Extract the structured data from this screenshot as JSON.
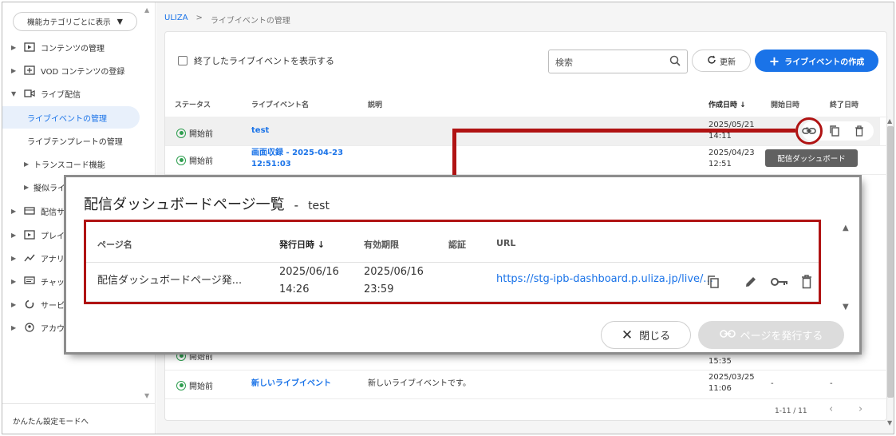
{
  "sidebar": {
    "category_button": "機能カテゴリごとに表示",
    "items": [
      {
        "label": "コンテンツの管理",
        "icon": "play-box-icon"
      },
      {
        "label": "VOD コンテンツの登録",
        "icon": "add-box-icon"
      },
      {
        "label": "ライブ配信",
        "icon": "video-camera-icon"
      },
      {
        "label": "ライブイベントの管理"
      },
      {
        "label": "ライブテンプレートの管理"
      },
      {
        "label": "トランスコード機能"
      },
      {
        "label": "擬似ライ"
      },
      {
        "label": "配信サ",
        "icon": "monitor-icon"
      },
      {
        "label": "プレイ",
        "icon": "player-icon"
      },
      {
        "label": "アナリ",
        "icon": "analytics-icon"
      },
      {
        "label": "チャッ",
        "icon": "chat-icon"
      },
      {
        "label": "サービ",
        "icon": "service-icon"
      },
      {
        "label": "アカウ",
        "icon": "account-icon"
      }
    ],
    "footer": "かんたん設定モードへ"
  },
  "breadcrumb": {
    "home": "ULIZA",
    "separator": ">",
    "current": "ライブイベントの管理"
  },
  "toolbar": {
    "show_finished": "終了したライブイベントを表示する",
    "search_placeholder": "検索",
    "refresh": "更新",
    "create": "ライブイベントの作成"
  },
  "table": {
    "headers": {
      "status": "ステータス",
      "name": "ライブイベント名",
      "description": "説明",
      "created": "作成日時",
      "start": "開始日時",
      "end": "終了日時"
    },
    "rows": [
      {
        "status": "開始前",
        "name": "test",
        "description": "",
        "created_date": "2025/05/21",
        "created_time": "14:11"
      },
      {
        "status": "開始前",
        "name_line1": "画面収録 - 2025-04-23",
        "name_line2": "12:51:03",
        "created_date": "2025/04/23",
        "created_time": "12:51"
      },
      {
        "status": "開始前",
        "partial_time": "15:35"
      },
      {
        "status": "開始前",
        "name": "新しいライブイベント",
        "description": "新しいライブイベントです。",
        "created_date": "2025/03/25",
        "created_time": "11:06",
        "start": "-",
        "end": "-"
      }
    ],
    "tooltip": "配信ダッシュボード",
    "pagination": "1-11 / 11"
  },
  "dialog": {
    "title": "配信ダッシュボードページ一覧",
    "separator": "-",
    "event_name": "test",
    "headers": {
      "page_name": "ページ名",
      "issued": "発行日時",
      "expiry": "有効期限",
      "auth": "認証",
      "url": "URL"
    },
    "row": {
      "page_name": "配信ダッシュボードページ発...",
      "issued_date": "2025/06/16",
      "issued_time": "14:26",
      "expiry_date": "2025/06/16",
      "expiry_time": "23:59",
      "auth": "",
      "url": "https://stg-ipb-dashboard.p.uliza.jp/live/..."
    },
    "close": "閉じる",
    "issue": "ページを発行する"
  },
  "colors": {
    "accent": "#1a73e8",
    "callout": "#b01313",
    "status_green": "#2e9e4f"
  }
}
